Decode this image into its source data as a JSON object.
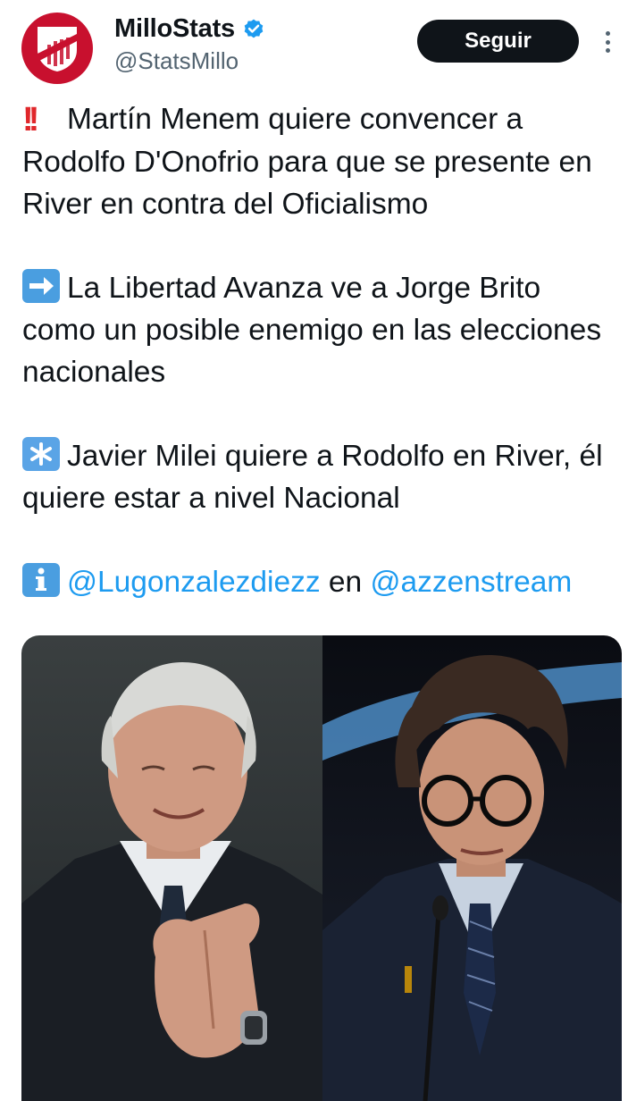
{
  "author": {
    "display_name": "MilloStats",
    "handle": "@StatsMillo",
    "verified": true,
    "avatar_icon": "river-plate-shield-icon"
  },
  "actions": {
    "follow_label": "Seguir",
    "more_icon": "more-vertical-icon"
  },
  "tweet": {
    "paragraphs": [
      {
        "emoji": "double-exclamation-icon",
        "text": "Martín Menem quiere convencer a Rodolfo D'Onofrio para que se presente en River en contra del Oficialismo"
      },
      {
        "emoji": "right-arrow-icon",
        "text": "La Libertad Avanza ve a Jorge Brito como un posible enemigo en las elecciones nacionales"
      },
      {
        "emoji": "asterisk-icon",
        "text": "Javier Milei quiere a Rodolfo en River, él quiere estar a nivel Nacional"
      }
    ],
    "source": {
      "emoji": "info-icon",
      "mention_1": "@Lugonzalezdiezz",
      "connector": "en",
      "mention_2": "@azzenstream"
    }
  },
  "media": {
    "left_photo": "older-man-clapping-photo",
    "right_photo": "man-with-glasses-at-microphone-photo"
  },
  "colors": {
    "accent": "#1d9bf0",
    "text": "#0f1419",
    "secondary": "#536471",
    "follow_bg": "#0f1419",
    "avatar_bg": "#c8102e"
  }
}
